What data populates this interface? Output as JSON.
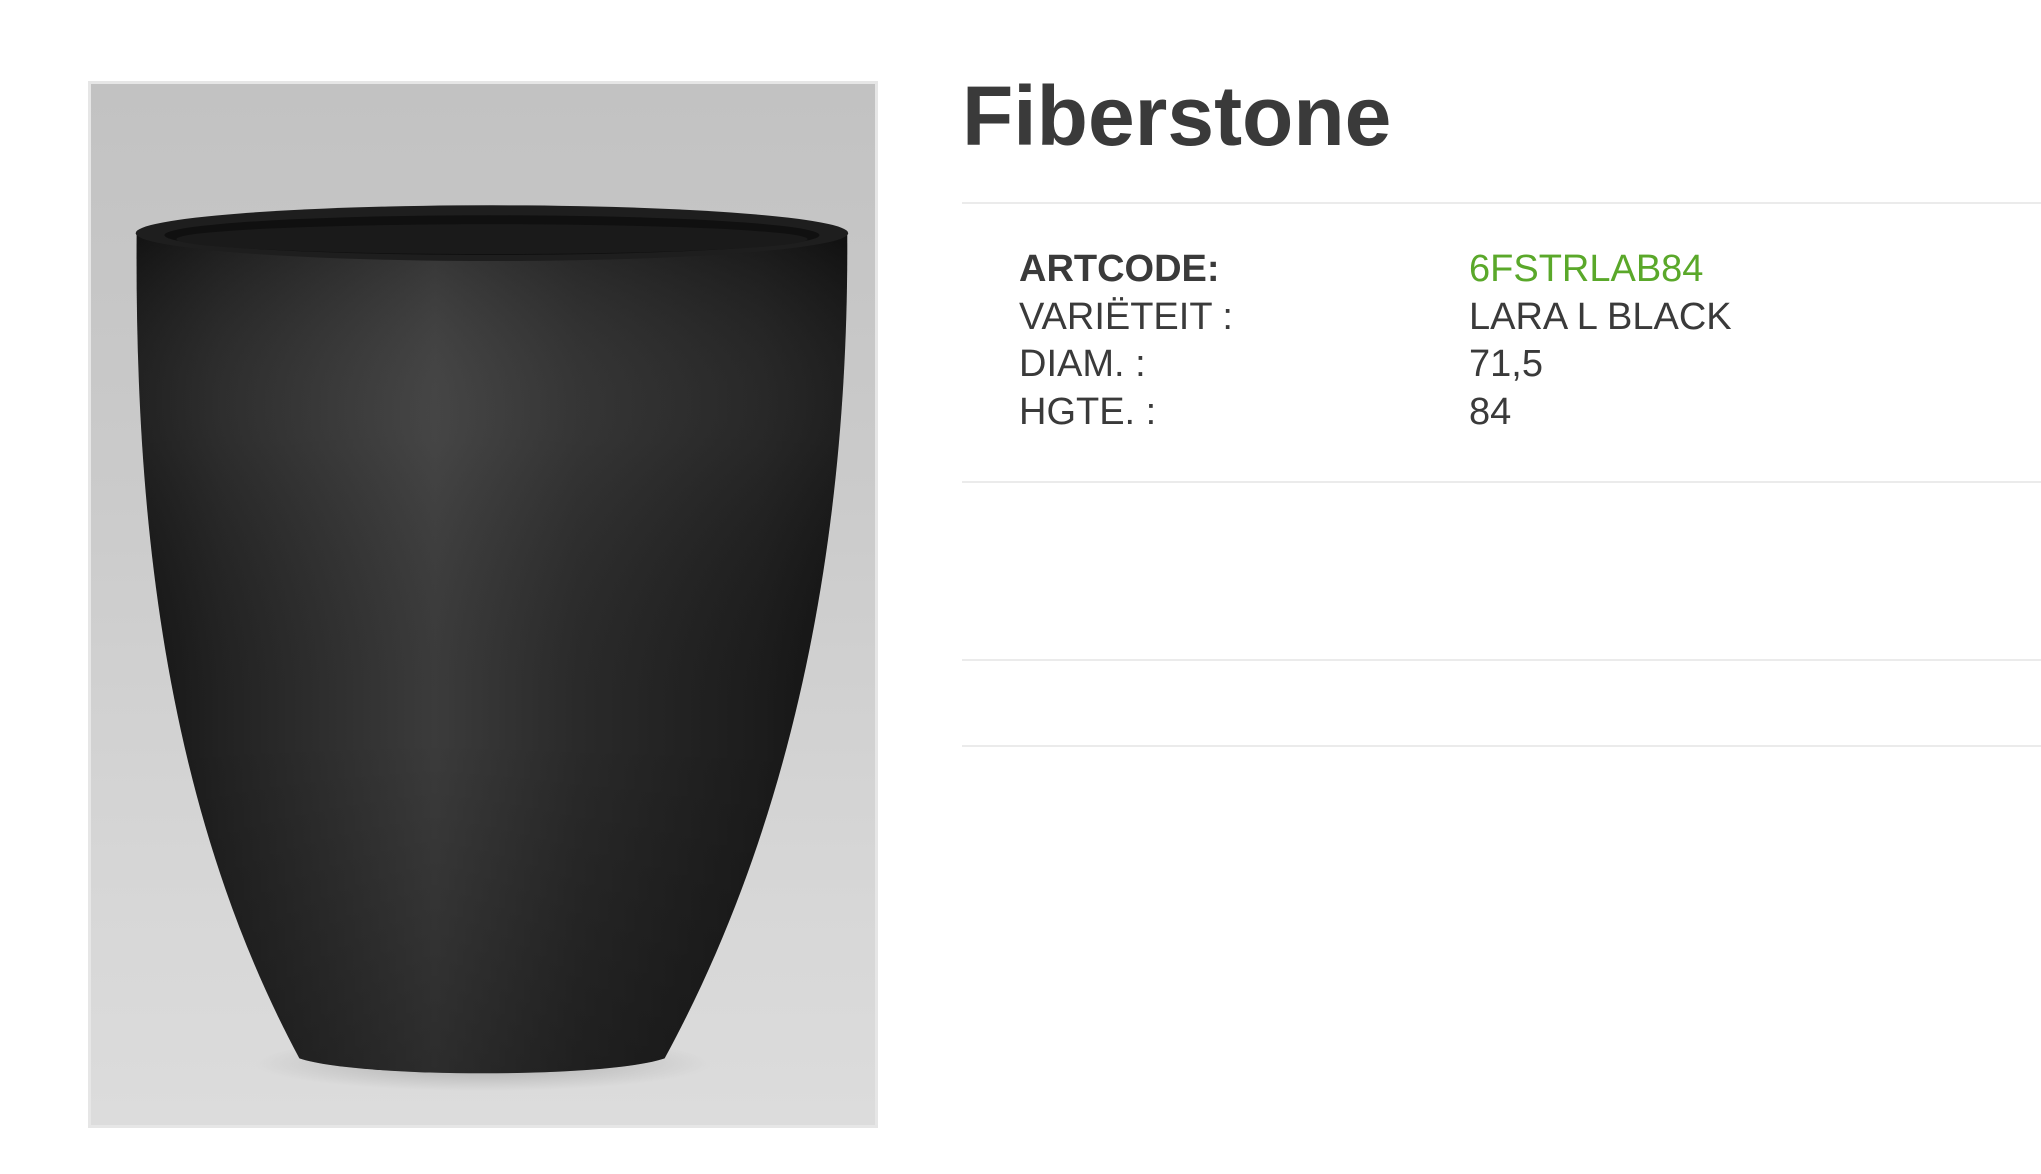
{
  "product": {
    "title": "Fiberstone",
    "image_alt": "Black fiberstone planter",
    "specs": [
      {
        "label": "ARTCODE:",
        "value": "6FSTRLAB84"
      },
      {
        "label": "VARIËTEIT :",
        "value": "LARA L BLACK"
      },
      {
        "label": "DIAM. :",
        "value": "71,5"
      },
      {
        "label": "HGTE. :",
        "value": "84"
      }
    ]
  },
  "colors": {
    "accent": "#5aa82a",
    "text": "#3a3a3a",
    "divider": "#ebebeb"
  }
}
